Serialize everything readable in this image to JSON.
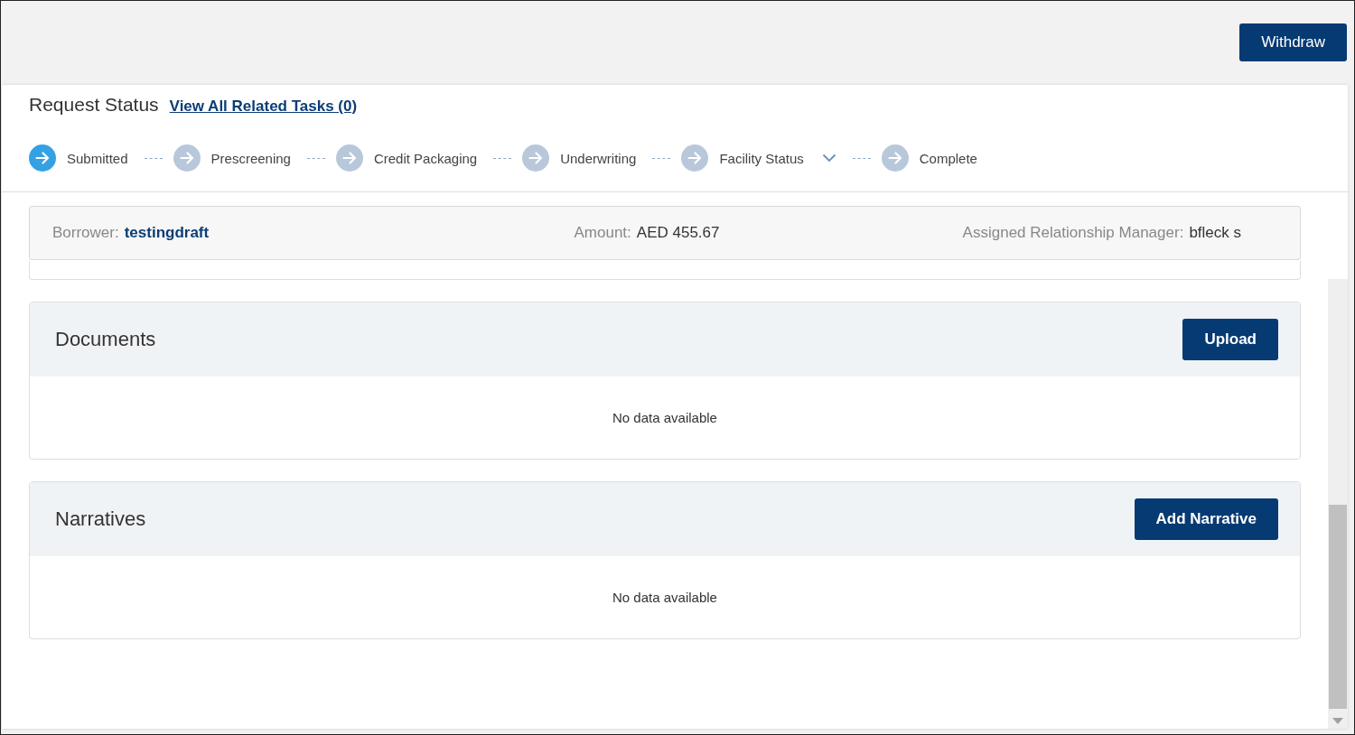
{
  "top_bar": {
    "button": "Withdraw"
  },
  "request_status": {
    "title": "Request Status",
    "link": "View All Related Tasks (0)",
    "steps": [
      {
        "label": "Submitted",
        "selected": true,
        "has_dropdown": false
      },
      {
        "label": "Prescreening",
        "selected": false,
        "has_dropdown": false
      },
      {
        "label": "Credit Packaging",
        "selected": false,
        "has_dropdown": false
      },
      {
        "label": "Underwriting",
        "selected": false,
        "has_dropdown": false
      },
      {
        "label": "Facility Status",
        "selected": false,
        "has_dropdown": true
      },
      {
        "label": "Complete",
        "selected": false,
        "has_dropdown": false
      }
    ]
  },
  "summary": [
    {
      "label": "Borrower:",
      "value": "testingdraft",
      "kind": "link"
    },
    {
      "label": "Amount:",
      "value": "AED 455.67",
      "kind": "text"
    },
    {
      "label": "Assigned Relationship Manager:",
      "value": "bfleck s",
      "kind": "text"
    }
  ],
  "sections": [
    {
      "title": "Documents",
      "button": "Upload",
      "empty_text": "No data available"
    },
    {
      "title": "Narratives",
      "button": "Add Narrative",
      "empty_text": "No data available"
    }
  ]
}
